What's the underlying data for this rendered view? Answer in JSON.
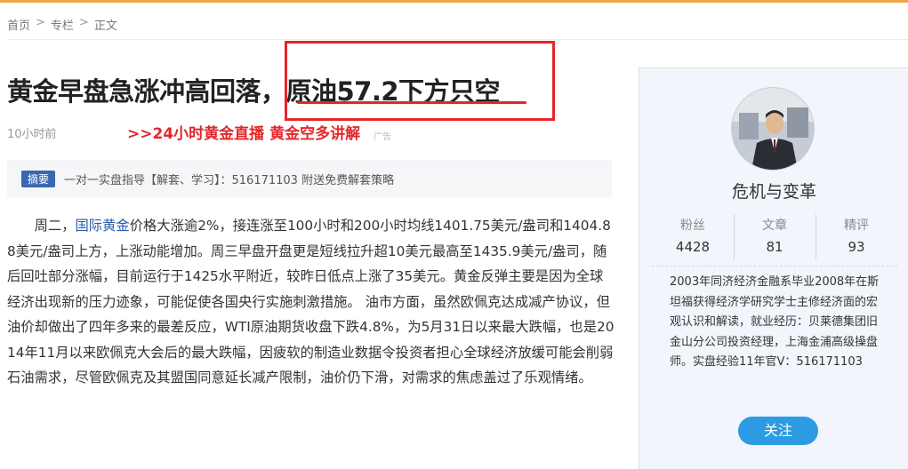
{
  "breadcrumb": {
    "home": "首页",
    "column": "专栏",
    "current": "正文",
    "separator": ">"
  },
  "article": {
    "title": "黄金早盘急涨冲高回落，原油57.2下方只空",
    "time": "10小时前",
    "ad_link": ">>24小时黄金直播 黄金空多讲解",
    "ad_tag": "广告",
    "summary_badge": "摘要",
    "summary": "一对一实盘指导【解套、学习】：516171103 附送免费解套策略",
    "body_pre": "周二，",
    "body_link": "国际黄金",
    "body_post": "价格大涨逾2%，接连涨至100小时和200小时均线1401.75美元/盎司和1404.88美元/盎司上方，上涨动能增加。周三早盘开盘更是短线拉升超10美元最高至1435.9美元/盎司，随后回吐部分涨幅，目前运行于1425水平附近，较昨日低点上涨了35美元。黄金反弹主要是因为全球经济出现新的压力迹象，可能促使各国央行实施刺激措施。 油市方面，虽然欧佩克达成减产协议，但油价却做出了四年多来的最差反应，WTI原油期货收盘下跌4.8%，为5月31日以来最大跌幅，也是2014年11月以来欧佩克大会后的最大跌幅，因疲软的制造业数据令投资者担心全球经济放缓可能会削弱石油需求，尽管欧佩克及其盟国同意延长减产限制，油价仍下滑，对需求的焦虑盖过了乐观情绪。"
  },
  "author": {
    "name": "危机与变革",
    "stats": [
      {
        "label": "粉丝",
        "value": "4428"
      },
      {
        "label": "文章",
        "value": "81"
      },
      {
        "label": "精评",
        "value": "93"
      }
    ],
    "bio": "2003年同济经济金融系毕业2008年在斯坦福获得经济学研究学士主修经济面的宏观认识和解读，就业经历：贝莱德集团旧金山分公司投资经理，上海金浦高级操盘师。实盘经验11年官V：516171103",
    "follow_label": "关注"
  },
  "colors": {
    "accent_red": "#e3262b",
    "link_blue": "#2a5caa",
    "button_blue": "#2d9be3",
    "badge_blue": "#3a67b0"
  }
}
